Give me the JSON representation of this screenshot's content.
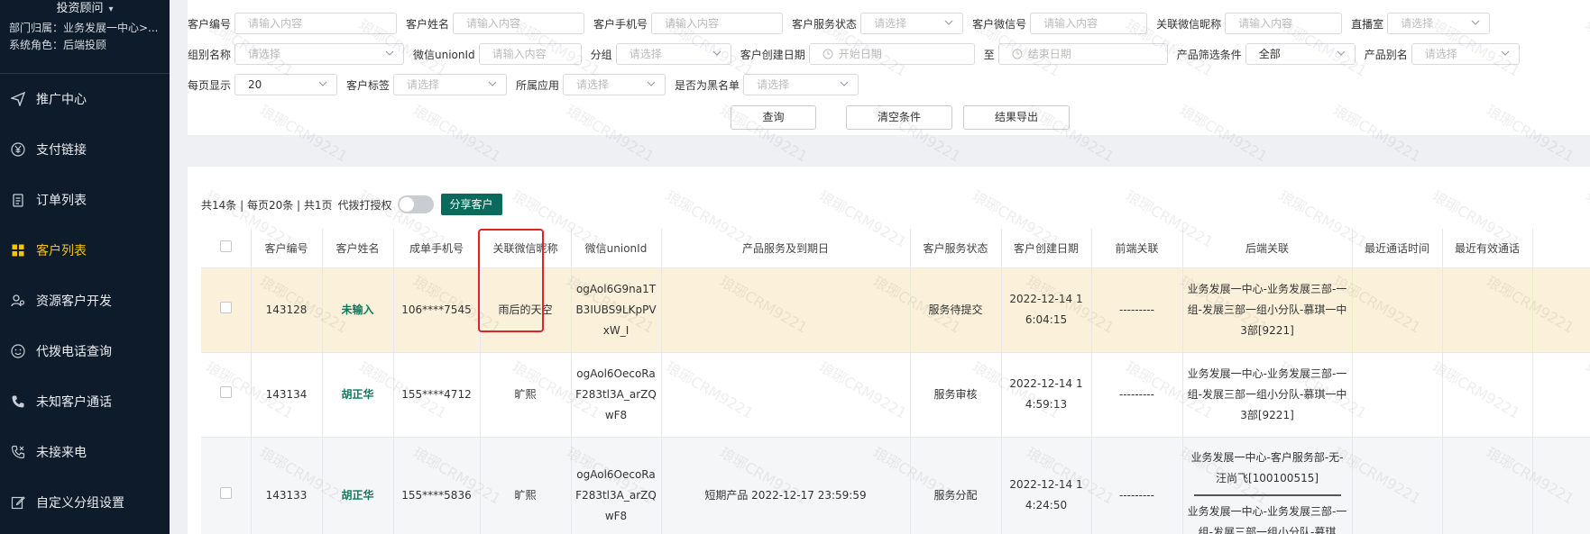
{
  "sidebar": {
    "role": "投资顾问",
    "dept": "部门归属：业务发展一中心>...",
    "sys_role": "系统角色：后端投顾",
    "items": [
      {
        "label": "推广中心",
        "icon": "send-icon"
      },
      {
        "label": "支付链接",
        "icon": "yen-icon"
      },
      {
        "label": "订单列表",
        "icon": "clipboard-icon"
      },
      {
        "label": "客户列表",
        "icon": "grid-icon",
        "active": true
      },
      {
        "label": "资源客户开发",
        "icon": "user-settings-icon"
      },
      {
        "label": "代拨电话查询",
        "icon": "smile-icon"
      },
      {
        "label": "未知客户通话",
        "icon": "phone-icon"
      },
      {
        "label": "未接来电",
        "icon": "phone-missed-icon"
      },
      {
        "label": "自定义分组设置",
        "icon": "edit-icon"
      }
    ]
  },
  "filters": {
    "customer_no": {
      "label": "客户编号",
      "placeholder": "请输入内容"
    },
    "customer_name": {
      "label": "客户姓名",
      "placeholder": "请输入内容"
    },
    "customer_phone": {
      "label": "客户手机号",
      "placeholder": "请输入内容"
    },
    "service_status": {
      "label": "客户服务状态",
      "placeholder": "请选择"
    },
    "wechat_no": {
      "label": "客户微信号",
      "placeholder": "请输入内容"
    },
    "wechat_nick": {
      "label": "关联微信昵称",
      "placeholder": "请输入内容"
    },
    "live_room": {
      "label": "直播室",
      "placeholder": "请选择"
    },
    "group_name": {
      "label": "组别名称",
      "placeholder": "请选择"
    },
    "unionid": {
      "label": "微信unionId",
      "placeholder": "请输入内容"
    },
    "subgroup": {
      "label": "分组",
      "placeholder": "请选择"
    },
    "create_date": {
      "label": "客户创建日期",
      "start": "开始日期",
      "to": "至",
      "end": "结束日期"
    },
    "product_filter": {
      "label": "产品筛选条件",
      "value": "全部"
    },
    "product_alias": {
      "label": "产品别名",
      "placeholder": "请选择"
    },
    "page_size": {
      "label": "每页显示",
      "value": "20"
    },
    "tag": {
      "label": "客户标签",
      "placeholder": "请选择"
    },
    "app": {
      "label": "所属应用",
      "placeholder": "请选择"
    },
    "blacklist": {
      "label": "是否为黑名单",
      "placeholder": "请选择"
    }
  },
  "buttons": {
    "query": "查询",
    "clear": "清空条件",
    "export": "结果导出"
  },
  "summary": {
    "text": "共14条 | 每页20条 | 共1页",
    "proxy_label": "代拨打授权",
    "proxy_on": false,
    "share": "分享客户"
  },
  "table": {
    "columns": [
      "客户编号",
      "客户姓名",
      "成单手机号",
      "关联微信昵称",
      "微信unionId",
      "产品服务及到期日",
      "客户服务状态",
      "客户创建日期",
      "前端关联",
      "后端关联",
      "最近通话时间",
      "最近有效通话"
    ],
    "rows": [
      {
        "no": "143128",
        "name": "未输入",
        "phone": "106****7545",
        "nick": "雨后的天空",
        "unionid": "ogAol6G9na1TB3IUBS9LKpPVxW_I",
        "product": "",
        "status": "服务待提交",
        "created": "2022-12-14 16:04:15",
        "front": "---------",
        "back": [
          "业务发展一中心-业务发展三部-一组-发展三部一组小分队-慕琪一中3部[9221]"
        ],
        "last_call": "",
        "last_valid": ""
      },
      {
        "no": "143134",
        "name": "胡正华",
        "phone": "155****4712",
        "nick": "旷熙",
        "unionid": "ogAol6OecoRaF283tl3A_arZQwF8",
        "product": "",
        "status": "服务审核",
        "created": "2022-12-14 14:59:13",
        "front": "---------",
        "back": [
          "业务发展一中心-业务发展三部-一组-发展三部一组小分队-慕琪一中3部[9221]"
        ],
        "last_call": "",
        "last_valid": ""
      },
      {
        "no": "143133",
        "name": "胡正华",
        "phone": "155****5836",
        "nick": "旷熙",
        "unionid": "ogAol6OecoRaF283tl3A_arZQwF8",
        "product": "短期产品 2022-12-17 23:59:59",
        "status": "服务分配",
        "created": "2022-12-14 14:24:50",
        "front": "---------",
        "back": [
          "业务发展一中心-客户服务部-无-汪尚飞[100100515]",
          "业务发展一中心-业务发展三部-一组-发展三部一组小分队-慕琪"
        ],
        "last_call": "",
        "last_valid": ""
      }
    ]
  },
  "watermark": "琅琊CRM9221",
  "colors": {
    "sidebar_bg": "#0e1b2a",
    "active": "#f6c400",
    "brand_green": "#0a6a5c",
    "highlight": "#e02424",
    "row_highlight": "#fbf0d9"
  }
}
